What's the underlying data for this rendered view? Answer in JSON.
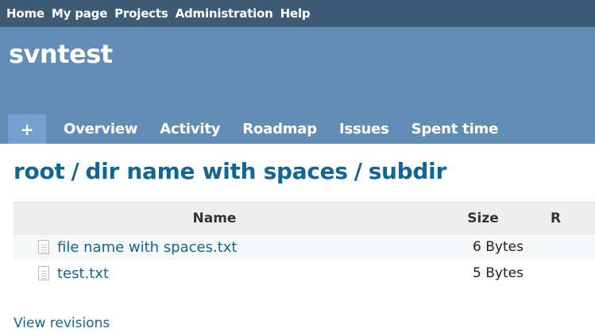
{
  "top_menu": {
    "items": [
      {
        "label": "Home"
      },
      {
        "label": "My page"
      },
      {
        "label": "Projects"
      },
      {
        "label": "Administration"
      },
      {
        "label": "Help"
      }
    ]
  },
  "header": {
    "project_title": "svntest"
  },
  "main_menu": {
    "new_label": "+",
    "tabs": [
      {
        "label": "Overview"
      },
      {
        "label": "Activity"
      },
      {
        "label": "Roadmap"
      },
      {
        "label": "Issues"
      },
      {
        "label": "Spent time"
      }
    ]
  },
  "breadcrumb": {
    "parts": [
      "root",
      "dir name with spaces",
      "subdir"
    ],
    "separator": "/"
  },
  "entries": {
    "columns": [
      "Name",
      "Size",
      "R"
    ],
    "rows": [
      {
        "name": "file name with spaces.txt",
        "size": "6 Bytes",
        "icon": "file-text-icon"
      },
      {
        "name": "test.txt",
        "size": "5 Bytes",
        "icon": "file-text-icon"
      }
    ]
  },
  "links": {
    "view_revisions": "View revisions"
  },
  "colors": {
    "top_menu_bg": "#3e5b76",
    "header_bg": "#628db6",
    "new_tab_bg": "#759fcf",
    "link": "#116699"
  }
}
